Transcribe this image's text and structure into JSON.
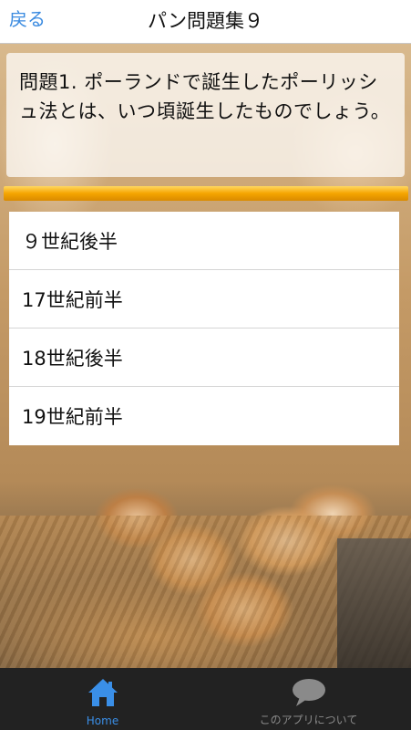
{
  "nav": {
    "back_label": "戻る",
    "title": "パン問題集９"
  },
  "question": {
    "text": "問題1. ポーランドで誕生したポーリッシュ法とは、いつ頃誕生したものでしょう。"
  },
  "progress": {
    "fraction": 1.0
  },
  "answers": [
    {
      "label": "９世紀後半"
    },
    {
      "label": "17世紀前半"
    },
    {
      "label": "18世紀後半"
    },
    {
      "label": "19世紀前半"
    }
  ],
  "tabbar": {
    "tabs": [
      {
        "label": "Home",
        "icon": "home-icon",
        "selected": true
      },
      {
        "label": "このアプリについて",
        "icon": "speech-bubble-icon",
        "selected": false
      }
    ]
  },
  "colors": {
    "accent": "#3b8be0",
    "progress": "#f5a500",
    "tabbar_bg": "#222222"
  }
}
